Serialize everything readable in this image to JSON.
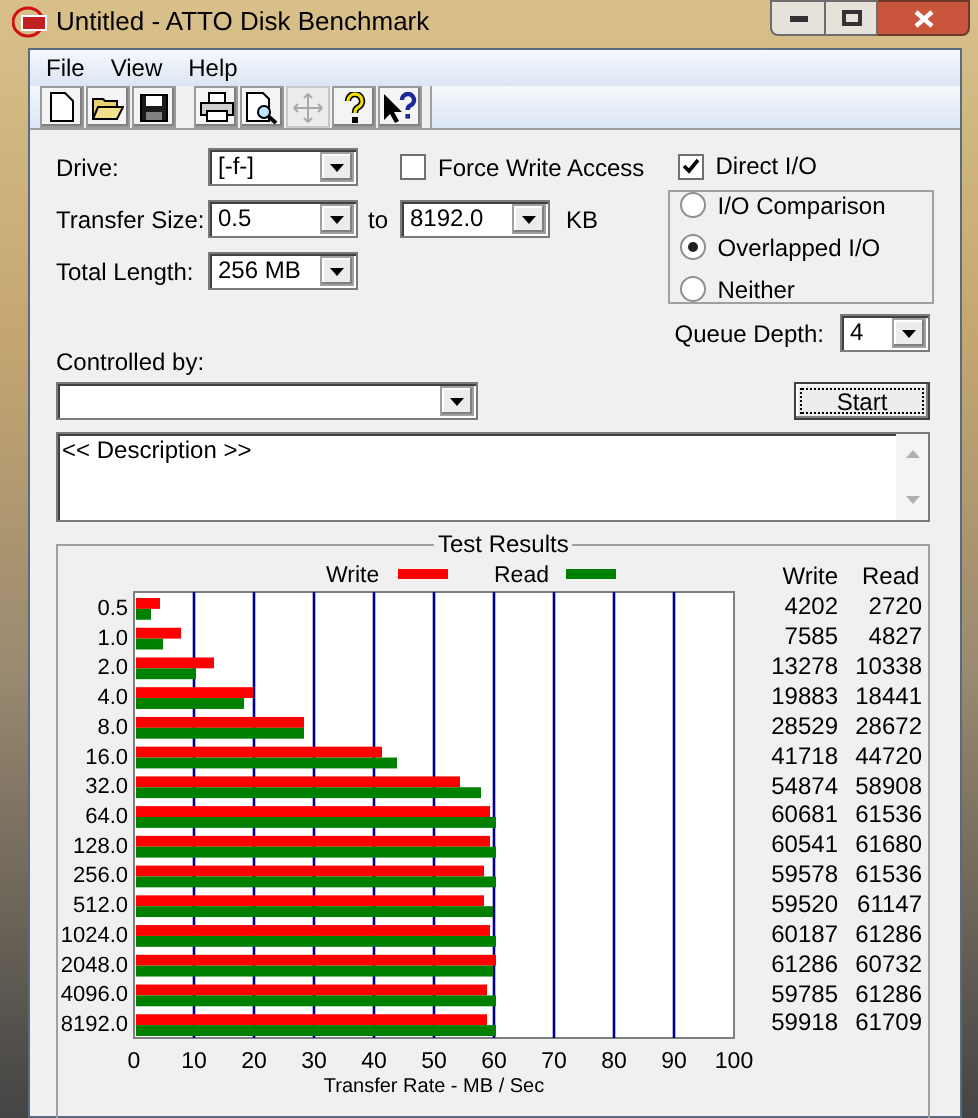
{
  "window": {
    "title": "Untitled - ATTO Disk Benchmark"
  },
  "menu": [
    "File",
    "View",
    "Help"
  ],
  "toolbar": [
    {
      "kind": "new",
      "disabled": false
    },
    {
      "kind": "open",
      "disabled": false
    },
    {
      "kind": "save",
      "disabled": false
    },
    {
      "kind": "print",
      "disabled": false
    },
    {
      "kind": "preview",
      "disabled": false
    },
    {
      "kind": "move",
      "disabled": true
    },
    {
      "kind": "help",
      "disabled": false
    },
    {
      "kind": "context_help",
      "disabled": false
    }
  ],
  "settings": {
    "drive": {
      "label": "Drive:",
      "value": "[-f-]"
    },
    "transfer_size": {
      "label": "Transfer Size:",
      "from": "0.5",
      "to_label": "to",
      "to": "8192.0",
      "unit": "KB"
    },
    "total_length": {
      "label": "Total Length:",
      "value": "256 MB"
    },
    "force_write_access": {
      "label": "Force Write Access",
      "checked": false
    },
    "direct_io": {
      "label": "Direct I/O",
      "checked": true
    },
    "io_modes": [
      {
        "label": "I/O Comparison",
        "selected": false
      },
      {
        "label": "Overlapped I/O",
        "selected": true
      },
      {
        "label": "Neither",
        "selected": false
      }
    ],
    "queue_depth": {
      "label": "Queue Depth:",
      "value": "4"
    },
    "controlled_by": {
      "label": "Controlled by:"
    }
  },
  "start_button": "Start",
  "description": "<< Description >>",
  "test_results": {
    "title": "Test Results",
    "columns": [
      "Write",
      "Read"
    ],
    "rows": [
      {
        "write": "4202",
        "read": "2720"
      },
      {
        "write": "7585",
        "read": "4827"
      },
      {
        "write": "13278",
        "read": "10338"
      },
      {
        "write": "19883",
        "read": "18441"
      },
      {
        "write": "28529",
        "read": "28672"
      },
      {
        "write": "41718",
        "read": "44720"
      },
      {
        "write": "54874",
        "read": "58908"
      },
      {
        "write": "60681",
        "read": "61536"
      },
      {
        "write": "60541",
        "read": "61680"
      },
      {
        "write": "59578",
        "read": "61536"
      },
      {
        "write": "59520",
        "read": "61147"
      },
      {
        "write": "60187",
        "read": "61286"
      },
      {
        "write": "61286",
        "read": "60732"
      },
      {
        "write": "59785",
        "read": "61286"
      },
      {
        "write": "59918",
        "read": "61709"
      }
    ],
    "chart_data": {
      "type": "bar",
      "orientation": "horizontal",
      "xlabel": "Transfer Rate - MB / Sec",
      "categories": [
        "0.5",
        "1.0",
        "2.0",
        "4.0",
        "8.0",
        "16.0",
        "32.0",
        "64.0",
        "128.0",
        "256.0",
        "512.0",
        "1024.0",
        "2048.0",
        "4096.0",
        "8192.0"
      ],
      "series": [
        {
          "name": "Write",
          "color": "#ff0000",
          "values": [
            4,
            7.5,
            13,
            19.5,
            28,
            41,
            54,
            59,
            59,
            58,
            58,
            59,
            60,
            58.5,
            58.5
          ]
        },
        {
          "name": "Read",
          "color": "#008000",
          "values": [
            2.5,
            4.5,
            10,
            18,
            28,
            43.5,
            57.5,
            60,
            60,
            60,
            59.5,
            60,
            59.5,
            60,
            60
          ]
        }
      ],
      "xlim": [
        0,
        100
      ],
      "xticks": [
        0,
        10,
        20,
        30,
        40,
        50,
        60,
        70,
        80,
        90,
        100
      ],
      "grid": true,
      "legend": true
    }
  }
}
